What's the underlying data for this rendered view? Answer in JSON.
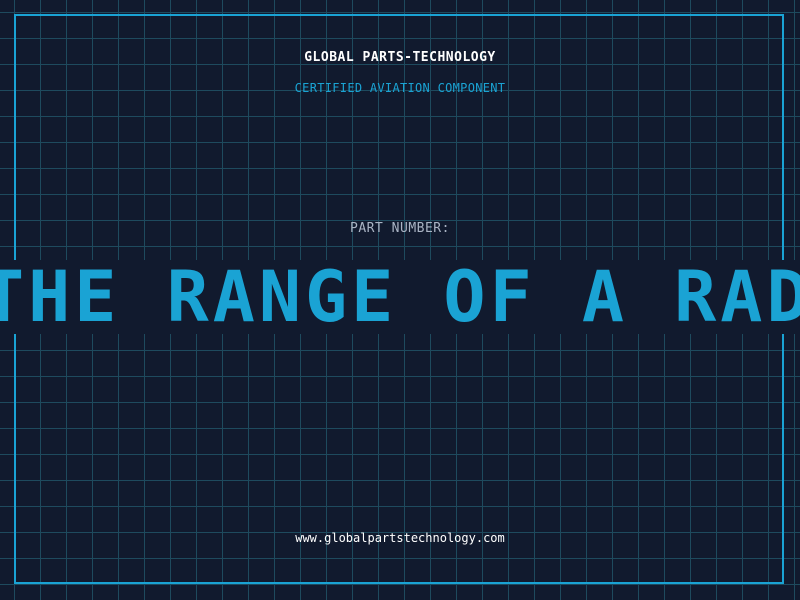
{
  "header": {
    "company": "GLOBAL PARTS-TECHNOLOGY",
    "subtitle": "CERTIFIED AVIATION COMPONENT"
  },
  "part": {
    "label": "PART NUMBER:",
    "number": "THE RANGE OF A RADA"
  },
  "footer": {
    "website": "www.globalpartstechnology.com"
  },
  "colors": {
    "background": "#111a2e",
    "grid": "#1e4a5e",
    "accent": "#1aa3d4",
    "text": "#ffffff",
    "muted": "#aab4c4"
  }
}
